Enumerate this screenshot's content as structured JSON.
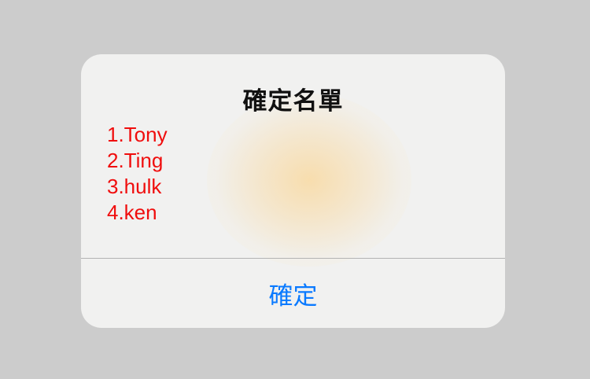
{
  "alert": {
    "title": "確定名單",
    "items": [
      "1.Tony",
      "2.Ting",
      "3.hulk",
      "4.ken"
    ],
    "confirm_label": "確定"
  },
  "colors": {
    "backdrop": "#cccccc",
    "alert_background": "#f1f1f0",
    "item_text": "#f00d0d",
    "button_text": "#0a7aff"
  }
}
